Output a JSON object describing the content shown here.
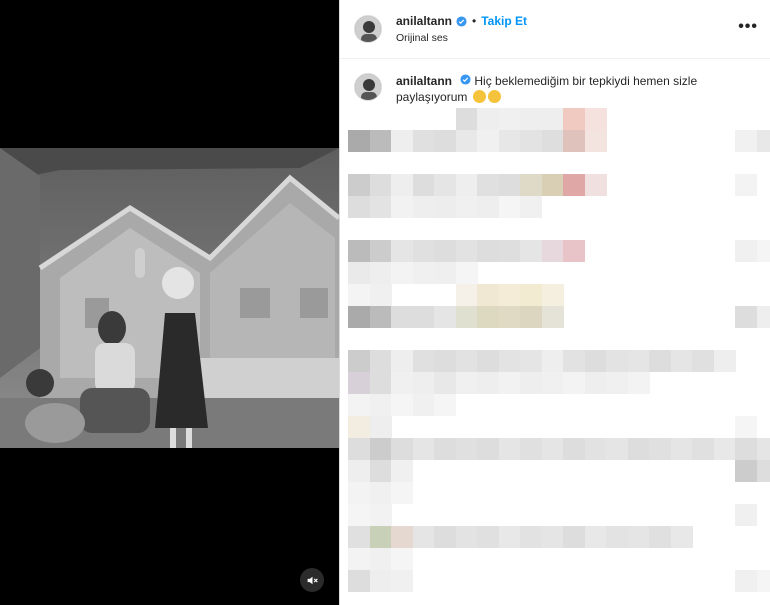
{
  "post": {
    "username": "anilaltann",
    "follow_label": "Takip Et",
    "audio_label": "Orijinal ses",
    "more_label": "•••",
    "caption": "Hiç beklemediğim bir tepkiydi hemen sizle paylaşıyorum"
  },
  "icons": {
    "verified": "verified-badge-icon",
    "mute": "speaker-muted-icon",
    "more": "more-options-icon"
  },
  "colors": {
    "accent": "#0095f6",
    "verified": "#3897f0"
  }
}
